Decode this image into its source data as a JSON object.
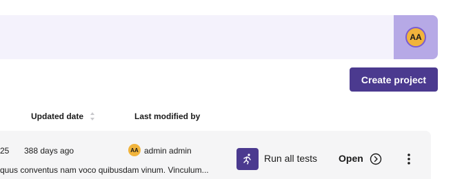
{
  "header": {
    "user_initials": "AA"
  },
  "toolbar": {
    "create_label": "Create project"
  },
  "table": {
    "columns": [
      "Updated date",
      "Last modified by"
    ],
    "rows": [
      {
        "date_fragment": "25",
        "updated": "388 days ago",
        "modified_by_initials": "AA",
        "modified_by": "admin admin",
        "description": "quus conventus nam voco quibusdam vinum. Vinculum...",
        "run_label": "Run all tests",
        "open_label": "Open"
      }
    ]
  },
  "colors": {
    "accent": "#4b3a8f",
    "avatar_bg": "#f1b43c",
    "header_bg": "#f4f2fc",
    "avatar_box_bg": "#b6a9e6"
  },
  "icons": {
    "sort": "sort-icon",
    "run": "running-person-icon",
    "open": "chevron-right-circle-icon",
    "more": "kebab-menu-icon"
  }
}
